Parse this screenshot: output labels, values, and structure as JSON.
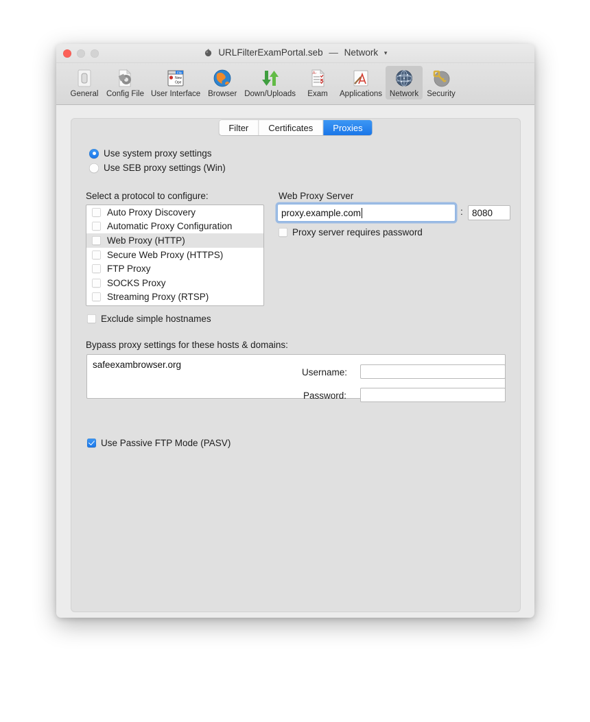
{
  "window": {
    "title_file": "URLFilterExamPortal.seb",
    "title_separator": "—",
    "title_section": "Network",
    "title_chevron": "▾",
    "title_icon": "seb-app-icon",
    "controls": {
      "close": "close-button",
      "minimize": "minimize-button",
      "maximize": "maximize-button"
    }
  },
  "toolbar": {
    "items": [
      {
        "label": "General",
        "icon": "general-icon",
        "selected": false
      },
      {
        "label": "Config File",
        "icon": "config-file-icon",
        "selected": false
      },
      {
        "label": "User Interface",
        "icon": "user-interface-icon",
        "selected": false
      },
      {
        "label": "Browser",
        "icon": "browser-globe-icon",
        "selected": false
      },
      {
        "label": "Down/Uploads",
        "icon": "up-down-arrows-icon",
        "selected": false
      },
      {
        "label": "Exam",
        "icon": "exam-checklist-icon",
        "selected": false
      },
      {
        "label": "Applications",
        "icon": "applications-icon",
        "selected": false
      },
      {
        "label": "Network",
        "icon": "network-globe-icon",
        "selected": true
      },
      {
        "label": "Security",
        "icon": "security-key-icon",
        "selected": false
      }
    ]
  },
  "tabs": [
    {
      "label": "Filter",
      "active": false
    },
    {
      "label": "Certificates",
      "active": false
    },
    {
      "label": "Proxies",
      "active": true
    }
  ],
  "proxy_mode": {
    "system": {
      "label": "Use system proxy settings",
      "selected": true
    },
    "seb": {
      "label": "Use SEB proxy settings (Win)",
      "selected": false
    }
  },
  "protocols": {
    "label": "Select a protocol to configure:",
    "items": [
      {
        "label": "Auto Proxy Discovery",
        "checked": false,
        "selected": false
      },
      {
        "label": "Automatic Proxy Configuration",
        "checked": false,
        "selected": false
      },
      {
        "label": "Web Proxy (HTTP)",
        "checked": false,
        "selected": true
      },
      {
        "label": "Secure Web Proxy (HTTPS)",
        "checked": false,
        "selected": false
      },
      {
        "label": "FTP Proxy",
        "checked": false,
        "selected": false
      },
      {
        "label": "SOCKS Proxy",
        "checked": false,
        "selected": false
      },
      {
        "label": "Streaming Proxy (RTSP)",
        "checked": false,
        "selected": false
      }
    ]
  },
  "exclude_simple_hostnames": {
    "label": "Exclude simple hostnames",
    "checked": false
  },
  "bypass": {
    "label": "Bypass proxy settings for these hosts & domains:",
    "value": "safeexambrowser.org",
    "placeholder": ""
  },
  "passive_ftp": {
    "label": "Use Passive FTP Mode (PASV)",
    "checked": true
  },
  "web_proxy_server": {
    "title": "Web Proxy Server",
    "host": {
      "value": "proxy.example.com",
      "placeholder": "",
      "focused": true
    },
    "colon": ":",
    "port": {
      "value": "8080",
      "placeholder": ""
    },
    "requires_password": {
      "label": "Proxy server requires password",
      "checked": false
    },
    "username": {
      "label": "Username:",
      "value": "",
      "placeholder": ""
    },
    "password": {
      "label": "Password:",
      "value": "",
      "placeholder": ""
    }
  },
  "colors": {
    "accent": "#1b77e9",
    "window_bg": "#ececec",
    "panel_bg": "#e0e0e0",
    "close_button": "#fc6058",
    "toolbar_selected": "#c9c9c9"
  }
}
